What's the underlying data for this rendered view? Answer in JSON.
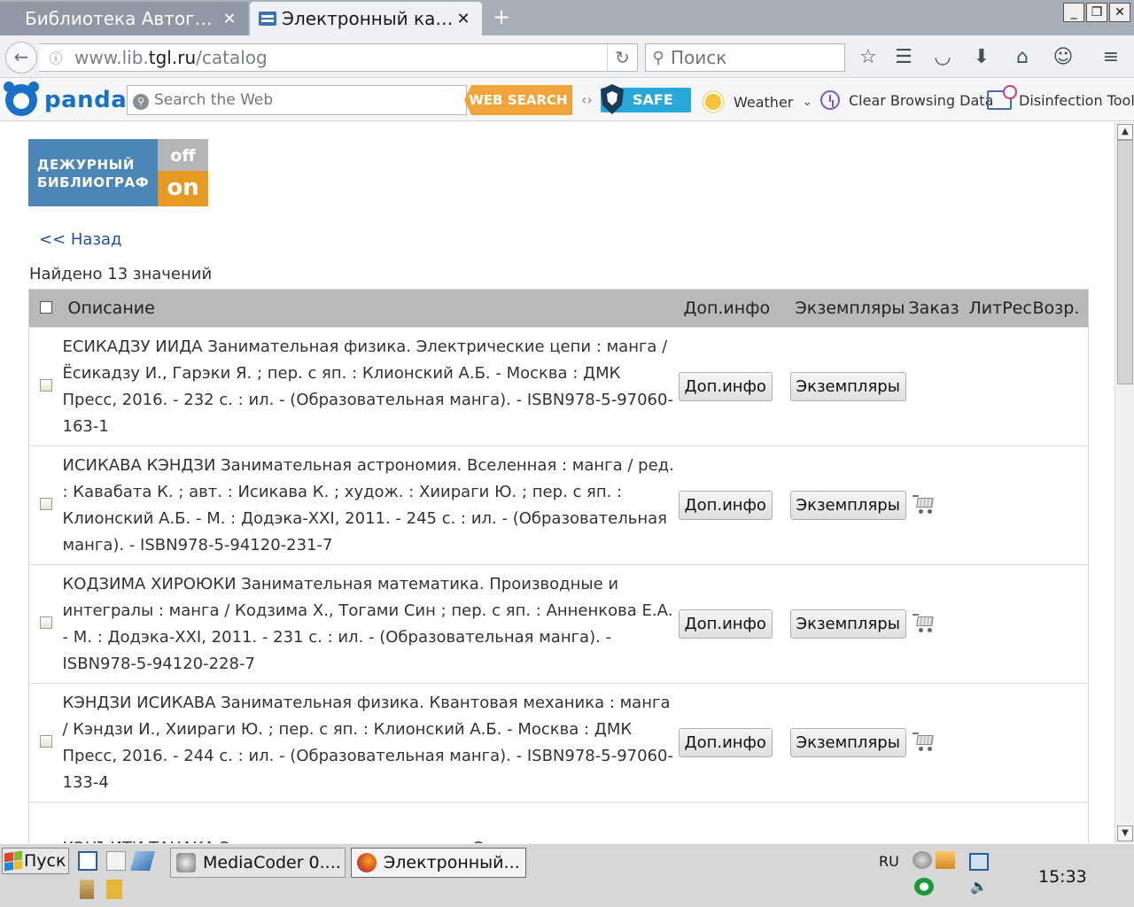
{
  "browser": {
    "tabs": [
      {
        "title": "Библиотека Автогр...",
        "active": false
      },
      {
        "title": "Электронный кат...",
        "active": true
      }
    ],
    "url": {
      "prefix": "www.lib.",
      "domain": "tgl.ru",
      "path": "/catalog"
    },
    "search_placeholder": "Поиск"
  },
  "panda": {
    "logo_text": "panda",
    "search_placeholder": "Search the Web",
    "search_button": "WEB SEARCH",
    "safe_label": "SAFE",
    "weather_label": "Weather",
    "clear_label": "Clear Browsing Data",
    "disinfect_label": "Disinfection Tools"
  },
  "page": {
    "banner": {
      "line1": "ДЕЖУРНЫЙ",
      "line2": "БИБЛИОГРАФ",
      "off": "off",
      "on": "on"
    },
    "back_link": "<< Назад",
    "found": "Найдено 13 значений",
    "columns": {
      "description": "Описание",
      "more_info": "Доп.инфо",
      "copies": "Экземпляры",
      "order": "Заказ",
      "litres": "ЛитРес",
      "return": "Возр."
    },
    "buttons": {
      "more_info": "Доп.инфо",
      "copies": "Экземпляры"
    },
    "results": [
      {
        "description": "ЕСИКАДЗУ ИИДА Занимательная физика. Электрические цепи : манга / Ёсикадзу И., Гарэки Я. ; пер. с яп. : Клионский А.Б. - Москва : ДМК Пресс, 2016. - 232 с. : ил. - (Образовательная манга). - ISBN978-5-97060-163-1",
        "orderable": false
      },
      {
        "description": "ИСИКАВА КЭНДЗИ Занимательная астрономия. Вселенная : манга / ред. : Кавабата К. ; авт. : Исикава К. ; худож. : Хиираги Ю. ; пер. с яп. : Клионский А.Б. - М. : Додэка-XXI, 2011. - 245 с. : ил. - (Образовательная манга). - ISBN978-5-94120-231-7",
        "orderable": true
      },
      {
        "description": "КОДЗИМА ХИРОЮКИ Занимательная математика. Производные и интегралы : манга / Кодзима Х., Тогами Син ; пер. с яп. : Анненкова Е.А. - М. : Додэка-XXI, 2011. - 231 с. : ил. - (Образовательная манга). - ISBN978-5-94120-228-7",
        "orderable": true
      },
      {
        "description": "КЭНДЗИ ИСИКАВА Занимательная физика. Квантовая механика : манга / Кэндзи И., Хиираги Ю. ; пер. с яп. : Клионский А.Б. - Москва : ДМК Пресс, 2016. - 244 с. : ил. - (Образовательная манга). - ISBN978-5-97060-133-4",
        "orderable": true
      },
      {
        "description": "КЭНЪИТИ ТАНАКА Занимательная электроника. Электронные схемы : манга / Кэнъити Т., Яко Т. ; пер. с яп. : Клионский А.Б. - Москва : ДМК",
        "orderable": true
      }
    ]
  },
  "taskbar": {
    "start_label": "Пуск",
    "tasks": [
      {
        "title": "MediaCoder 0....",
        "active": false
      },
      {
        "title": "Электронный...",
        "active": true
      }
    ],
    "lang": "RU",
    "time": "15:33"
  }
}
